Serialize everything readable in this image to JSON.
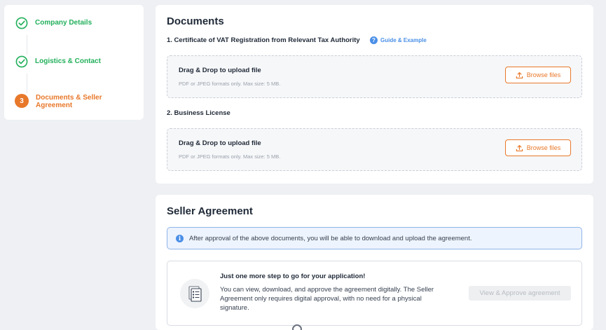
{
  "stepper": {
    "steps": [
      {
        "label": "Company Details",
        "status": "done"
      },
      {
        "label": "Logistics & Contact",
        "status": "done"
      },
      {
        "label": "Documents & Seller Agreement",
        "status": "current",
        "number": "3"
      }
    ]
  },
  "documents": {
    "title": "Documents",
    "guide_label": "Guide & Example",
    "items": [
      {
        "label": "1. Certificate of VAT Registration from Relevant Tax Authority",
        "dropzone_title": "Drag & Drop to upload file",
        "dropzone_hint": "PDF or JPEG formats only. Max size: 5 MB.",
        "button_label": "Browse files"
      },
      {
        "label": "2. Business License",
        "dropzone_title": "Drag & Drop to upload file",
        "dropzone_hint": "PDF or JPEG formats only. Max size: 5 MB.",
        "button_label": "Browse files"
      }
    ]
  },
  "agreement": {
    "title": "Seller Agreement",
    "info_text": "After approval of the above documents, you will be able to download and upload the agreement.",
    "box_title": "Just one more step to go for your application!",
    "box_description": "You can view, download, and approve the agreement digitally. The Seller Agreement only requires digital approval, with no need for a physical signature.",
    "approve_button": "View & Approve agreement"
  },
  "colors": {
    "accent_orange": "#e8782a",
    "success_green": "#22b05b",
    "info_blue": "#4a8fe7"
  },
  "icons": [
    "check-circle-icon",
    "question-icon",
    "upload-icon",
    "info-icon",
    "document-list-icon"
  ]
}
